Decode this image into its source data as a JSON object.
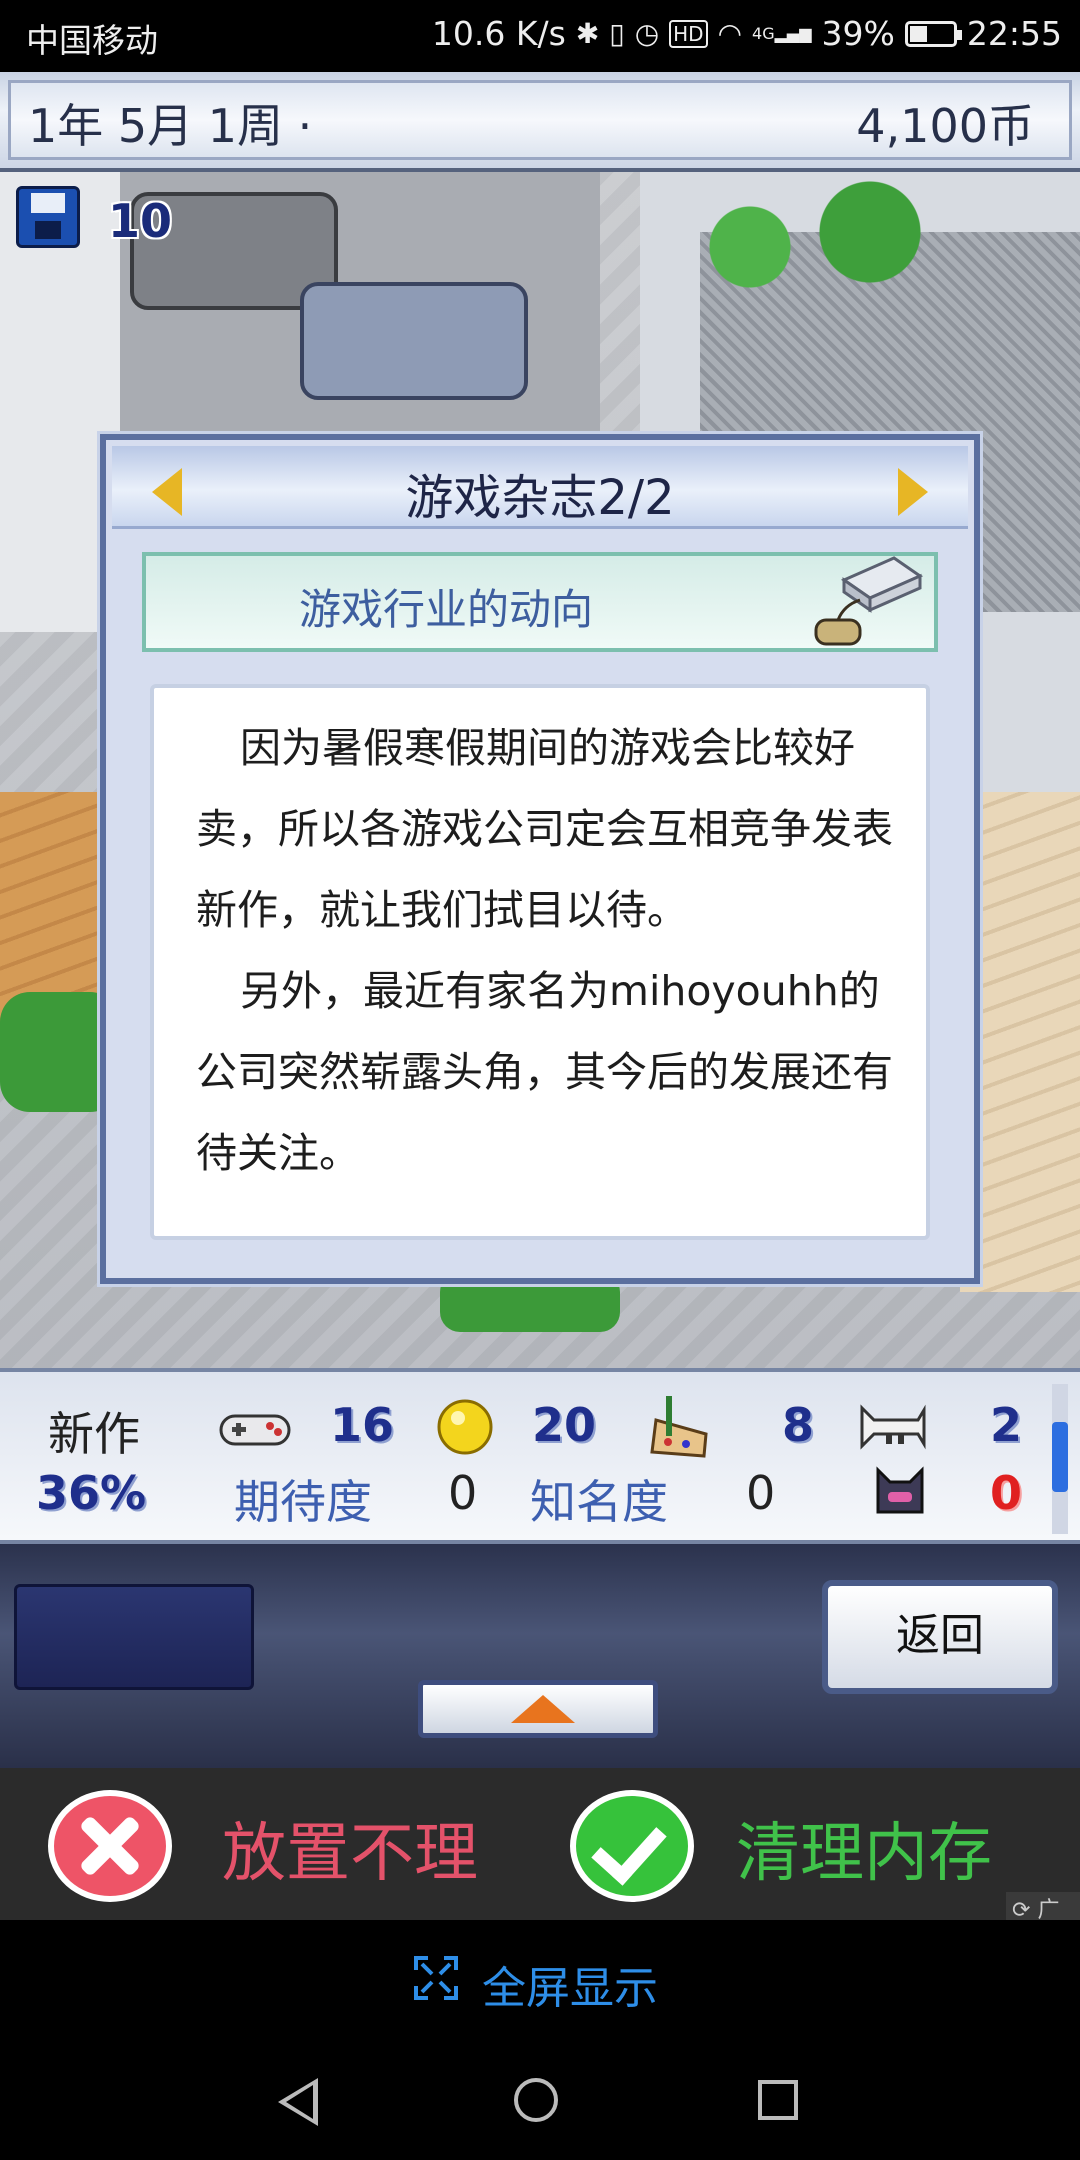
{
  "status_bar": {
    "carrier": "中国移动",
    "speed": "10.6 K/s",
    "network": "4G",
    "battery": "39%",
    "time": "22:55"
  },
  "top_bar": {
    "date": "1年 5月 1周 ·",
    "money": "4,100币"
  },
  "scene": {
    "save_count": "10"
  },
  "dialog": {
    "title": "游戏杂志2/2",
    "topic": "游戏行业的动向",
    "paragraphs": [
      "因为暑假寒假期间的游戏会比较好卖，所以各游戏公司定会互相竞争发表新作，就让我们拭目以待。",
      "另外，最近有家名为mihoyouhh的公司突然崭露头角，其今后的发展还有待关注。"
    ]
  },
  "stats": {
    "new_label": "新作",
    "new_percent": "36%",
    "fun": "16",
    "creativity": "20",
    "graphics": "8",
    "sound": "2",
    "expectation_label": "期待度",
    "expectation_value": "0",
    "fame_label": "知名度",
    "fame_value": "0",
    "bugs": "0"
  },
  "controls": {
    "back_label": "返回"
  },
  "ad": {
    "left_label": "放置不理",
    "right_label": "清理内存",
    "tag": "广告"
  },
  "fullscreen": {
    "label": "全屏显示"
  },
  "colors": {
    "accent_blue": "#2e8ee8",
    "ad_red": "#e4526a",
    "ad_green": "#40c24a",
    "stat_blue": "#1f2f8c"
  }
}
